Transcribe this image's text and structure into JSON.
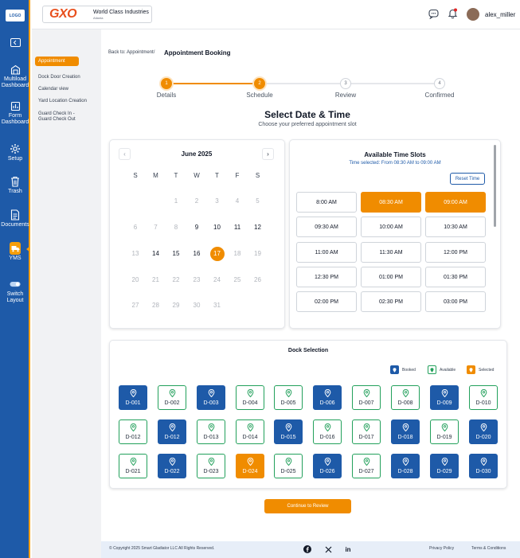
{
  "nav_rail": {
    "items": [
      {
        "label": "Multiload\nDashboard",
        "icon": "multiload-dashboard-icon"
      },
      {
        "label": "Form\nDashboard",
        "icon": "form-dashboard-icon"
      },
      {
        "label": "Setup",
        "icon": "gear-icon"
      },
      {
        "label": "Trash",
        "icon": "trash-icon"
      },
      {
        "label": "Documents",
        "icon": "document-icon"
      },
      {
        "label": "YMS",
        "icon": "truck-icon"
      },
      {
        "label": "Switch\nLayout",
        "icon": "toggle-icon"
      }
    ]
  },
  "subnav": {
    "active": "Appointment",
    "items": [
      "Dock Door Creation",
      "Calendar view",
      "Yard Location Creation",
      "Guard Check In -\nGuard Check Out"
    ]
  },
  "header": {
    "brand": "GXO",
    "org_name": "World Class Industries",
    "org_sub": "Atlanta",
    "username": "alex_miller"
  },
  "breadcrumb": {
    "back": "Back to: Appointment/",
    "current": "Appointment Booking"
  },
  "stepper": [
    {
      "num": "1",
      "label": "Details",
      "state": "done"
    },
    {
      "num": "2",
      "label": "Schedule",
      "state": "done"
    },
    {
      "num": "3",
      "label": "Review",
      "state": "todo"
    },
    {
      "num": "4",
      "label": "Confirmed",
      "state": "todo"
    }
  ],
  "section": {
    "title": "Select Date & Time",
    "subtitle": "Choose your preferred appointment slot"
  },
  "calendar": {
    "month": "June 2025",
    "prev": "‹",
    "next": "›",
    "dow": [
      "S",
      "M",
      "T",
      "W",
      "T",
      "F",
      "S"
    ],
    "weeks": [
      [
        null,
        null,
        "1",
        "2",
        "3",
        "4",
        "5"
      ],
      [
        "6",
        "7",
        "8",
        "9",
        "10",
        "11",
        "12"
      ],
      [
        "13",
        "14",
        "15",
        "16",
        "17",
        "18",
        "19"
      ],
      [
        "20",
        "21",
        "22",
        "23",
        "24",
        "25",
        "26"
      ],
      [
        "27",
        "28",
        "29",
        "30",
        "31",
        null,
        null
      ]
    ],
    "active_days": [
      "9",
      "10",
      "11",
      "12",
      "14",
      "15",
      "16"
    ],
    "selected_day": "17"
  },
  "time_slots": {
    "title": "Available Time Slots",
    "selected_text": "Time selected: From 08:30 AM to 09:00 AM",
    "reset_label": "Reset Time",
    "slots": [
      "8:00 AM",
      "08:30 AM",
      "09:00 AM",
      "09:30 AM",
      "10:00 AM",
      "10:30 AM",
      "11:00 AM",
      "11:30 AM",
      "12:00 PM",
      "12:30 PM",
      "01:00 PM",
      "01:30 PM",
      "02:00 PM",
      "02:30 PM",
      "03:00 PM"
    ],
    "selected": [
      "08:30 AM",
      "09:00 AM"
    ]
  },
  "dock": {
    "title": "Dock Selection",
    "legend": [
      {
        "label": "Booked",
        "state": "booked"
      },
      {
        "label": "Available",
        "state": "available"
      },
      {
        "label": "Selected",
        "state": "selected"
      }
    ],
    "rows": [
      [
        [
          "D-001",
          "booked"
        ],
        [
          "D-002",
          "available"
        ],
        [
          "D-003",
          "booked"
        ],
        [
          "D-004",
          "available"
        ],
        [
          "D-005",
          "available"
        ],
        [
          "D-006",
          "booked"
        ],
        [
          "D-007",
          "available"
        ],
        [
          "D-008",
          "available"
        ],
        [
          "D-009",
          "booked"
        ],
        [
          "D-010",
          "available"
        ]
      ],
      [
        [
          "D-012",
          "available"
        ],
        [
          "D-012",
          "booked"
        ],
        [
          "D-013",
          "available"
        ],
        [
          "D-014",
          "available"
        ],
        [
          "D-015",
          "booked"
        ],
        [
          "D-016",
          "available"
        ],
        [
          "D-017",
          "available"
        ],
        [
          "D-018",
          "booked"
        ],
        [
          "D-019",
          "available"
        ],
        [
          "D-020",
          "booked"
        ]
      ],
      [
        [
          "D-021",
          "available"
        ],
        [
          "D-022",
          "booked"
        ],
        [
          "D-023",
          "available"
        ],
        [
          "D-024",
          "selected"
        ],
        [
          "D-025",
          "available"
        ],
        [
          "D-026",
          "booked"
        ],
        [
          "D-027",
          "available"
        ],
        [
          "D-028",
          "booked"
        ],
        [
          "D-029",
          "booked"
        ],
        [
          "D-030",
          "booked"
        ]
      ]
    ]
  },
  "continue_label": "Continue to Review",
  "footer": {
    "copyright": "© Copyright 2025 Smart Gladiator LLC All Rights Reserved.",
    "privacy": "Privacy Policy",
    "terms": "Terms & Conditions",
    "social": [
      "facebook-icon",
      "x-icon",
      "linkedin-icon"
    ]
  },
  "colors": {
    "primary": "#1e5aa8",
    "accent": "#f08c00",
    "available": "#22a05b"
  }
}
